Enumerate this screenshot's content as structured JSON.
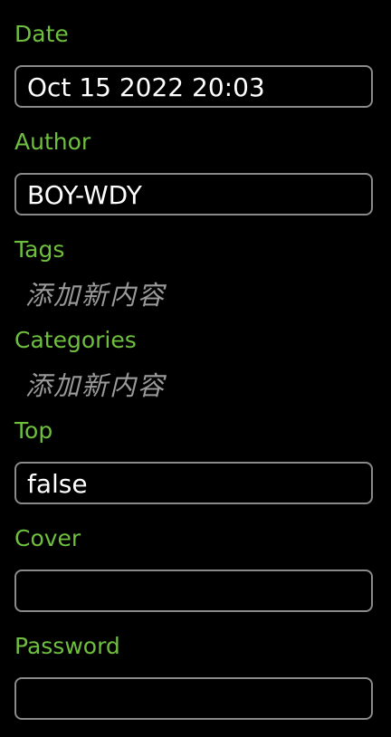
{
  "fields": {
    "date": {
      "label": "Date",
      "value": "Oct 15 2022 20:03"
    },
    "author": {
      "label": "Author",
      "value": "BOY-WDY"
    },
    "tags": {
      "label": "Tags",
      "add_text": "添加新内容"
    },
    "categories": {
      "label": "Categories",
      "add_text": "添加新内容"
    },
    "top": {
      "label": "Top",
      "value": "false"
    },
    "cover": {
      "label": "Cover",
      "value": ""
    },
    "password": {
      "label": "Password",
      "value": ""
    }
  },
  "colors": {
    "background": "#000000",
    "label": "#6fbf3f",
    "field_border": "#8a8a8a",
    "field_text": "#ffffff",
    "add_text": "#9a9a9a"
  }
}
